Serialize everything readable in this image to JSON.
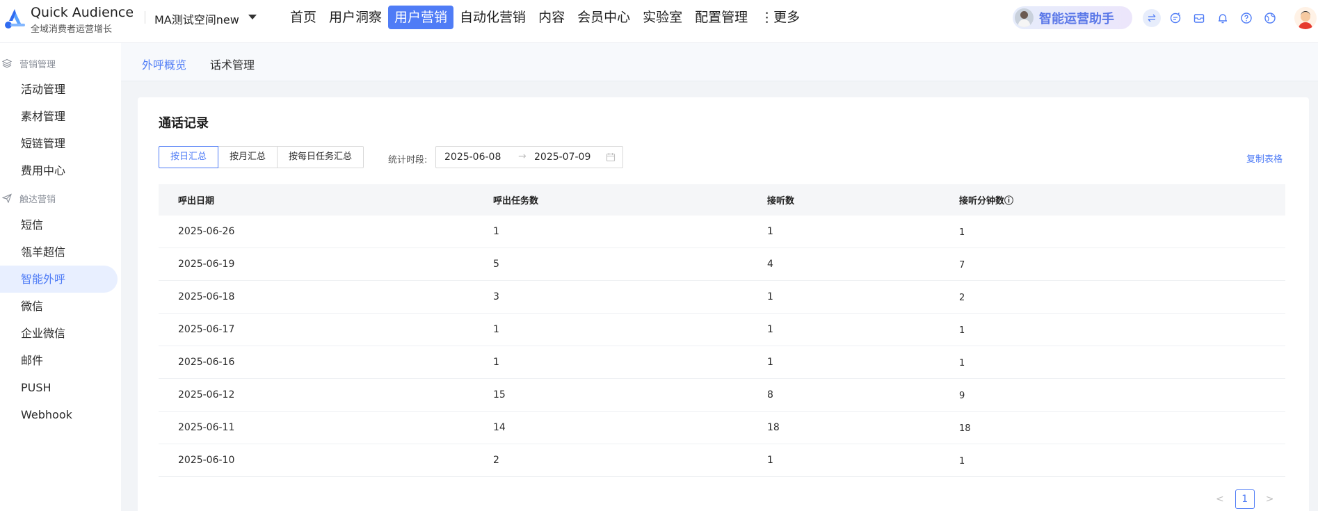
{
  "brand": {
    "title": "Quick Audience",
    "subtitle": "全域消费者运营增长"
  },
  "workspace": {
    "name": "MA测试空间new"
  },
  "top_nav": [
    {
      "label": "首页",
      "active": false
    },
    {
      "label": "用户洞察",
      "active": false
    },
    {
      "label": "用户营销",
      "active": true
    },
    {
      "label": "自动化营销",
      "active": false
    },
    {
      "label": "内容",
      "active": false
    },
    {
      "label": "会员中心",
      "active": false
    },
    {
      "label": "实验室",
      "active": false
    },
    {
      "label": "配置管理",
      "active": false
    },
    {
      "label": "⋮更多",
      "active": false
    }
  ],
  "assistant": {
    "label": "智能运营助手"
  },
  "toolbar_icons": [
    "swap-icon",
    "ai-chat-icon",
    "inbox-icon",
    "bell-icon",
    "help-icon",
    "globe-icon"
  ],
  "sidebar": {
    "groups": [
      {
        "title": "营销管理",
        "icon": "layers-icon",
        "items": [
          "活动管理",
          "素材管理",
          "短链管理",
          "费用中心"
        ]
      },
      {
        "title": "触达营销",
        "icon": "send-icon",
        "items": [
          "短信",
          "瓴羊超信",
          "智能外呼",
          "微信",
          "企业微信",
          "邮件",
          "PUSH",
          "Webhook"
        ]
      }
    ],
    "active_item": "智能外呼"
  },
  "sub_tabs": [
    {
      "label": "外呼概览",
      "active": true
    },
    {
      "label": "话术管理",
      "active": false
    }
  ],
  "card": {
    "title": "通话记录",
    "segments": [
      {
        "label": "按日汇总",
        "active": true
      },
      {
        "label": "按月汇总",
        "active": false
      },
      {
        "label": "按每日任务汇总",
        "active": false
      }
    ],
    "range_label": "统计时段:",
    "range_start": "2025-06-08",
    "range_arrow": "→",
    "range_end": "2025-07-09",
    "copy_label": "复制表格",
    "table": {
      "headers": [
        "呼出日期",
        "呼出任务数",
        "接听数",
        "接听分钟数ⓘ"
      ],
      "rows": [
        [
          "2025-06-26",
          "1",
          "1",
          "1"
        ],
        [
          "2025-06-19",
          "5",
          "4",
          "7"
        ],
        [
          "2025-06-18",
          "3",
          "1",
          "2"
        ],
        [
          "2025-06-17",
          "1",
          "1",
          "1"
        ],
        [
          "2025-06-16",
          "1",
          "1",
          "1"
        ],
        [
          "2025-06-12",
          "15",
          "8",
          "9"
        ],
        [
          "2025-06-11",
          "14",
          "18",
          "18"
        ],
        [
          "2025-06-10",
          "2",
          "1",
          "1"
        ]
      ]
    },
    "pagination": {
      "prev": "<",
      "current": "1",
      "next": ">"
    }
  }
}
